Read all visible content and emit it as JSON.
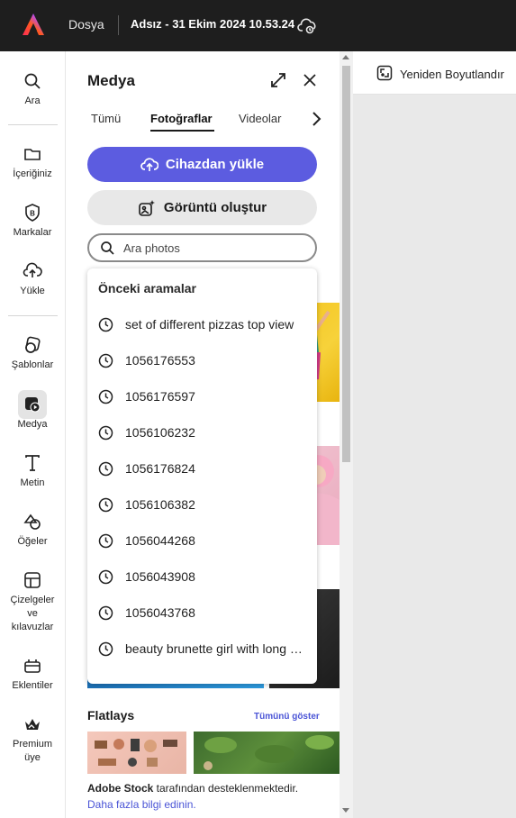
{
  "topbar": {
    "menu_file": "Dosya",
    "doc_title": "Adsız - 31 Ekim 2024 10.53.24"
  },
  "rail": {
    "items": [
      {
        "label": "Ara",
        "icon": "search-icon"
      },
      {
        "label": "İçeriğiniz",
        "icon": "folder-icon"
      },
      {
        "label": "Markalar",
        "icon": "brand-icon"
      },
      {
        "label": "Yükle",
        "icon": "upload-icon"
      },
      {
        "label": "Şablonlar",
        "icon": "templates-icon"
      },
      {
        "label": "Medya",
        "icon": "media-icon"
      },
      {
        "label": "Metin",
        "icon": "text-icon"
      },
      {
        "label": "Öğeler",
        "icon": "elements-icon"
      },
      {
        "label": "Çizelgeler ve kılavuzlar",
        "label_lines": [
          "Çizelgeler",
          "ve",
          "kılavuzlar"
        ],
        "icon": "grids-icon"
      },
      {
        "label": "Eklentiler",
        "icon": "addons-icon"
      },
      {
        "label": "Premium üye",
        "label_lines": [
          "Premium",
          "üye"
        ],
        "icon": "premium-crown-icon"
      }
    ],
    "active": "Medya"
  },
  "panel": {
    "title": "Medya",
    "tabs": [
      {
        "label": "Tümü"
      },
      {
        "label": "Fotoğraflar",
        "active": true
      },
      {
        "label": "Videolar"
      }
    ],
    "upload_button": "Cihazdan yükle",
    "generate_button": "Görüntü oluştur",
    "search": {
      "value": "",
      "placeholder": "Ara photos"
    },
    "section_title": "Flatlays",
    "show_all": "Tümünü göster",
    "footer": {
      "brand": "Adobe Stock",
      "text": " tarafından desteklenmektedir.",
      "link": "Daha fazla bilgi edinin."
    }
  },
  "dropdown": {
    "header": "Önceki aramalar",
    "items": [
      "set of different pizzas top view",
      "1056176553",
      "1056176597",
      "1056106232",
      "1056176824",
      "1056106382",
      "1056044268",
      "1056043908",
      "1056043768",
      "beauty brunette girl with long hair"
    ]
  },
  "canvas": {
    "resize_label": "Yeniden Boyutlandır"
  },
  "colors": {
    "accent": "#5c5ce0",
    "link": "#4a54d6",
    "topbar_bg": "#1e1e1e"
  }
}
